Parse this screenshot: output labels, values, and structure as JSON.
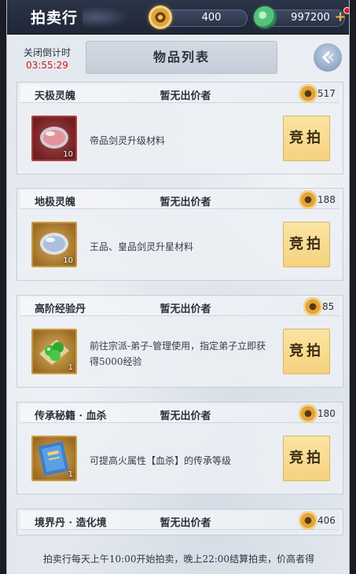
{
  "header": {
    "title": "拍卖行",
    "gold_amount": "400",
    "jade_amount": "997200",
    "plus_symbol": "+"
  },
  "subheader": {
    "countdown_label": "关闭倒计时",
    "countdown_time": "03:55:29",
    "list_title": "物品列表"
  },
  "items": [
    {
      "name": "天极灵魄",
      "bidder": "暂无出价者",
      "price": "517",
      "quantity": "10",
      "description": "帝品剑灵升级材料",
      "bid_label": "竞拍",
      "icon": "red-soul-stone-icon"
    },
    {
      "name": "地极灵魄",
      "bidder": "暂无出价者",
      "price": "188",
      "quantity": "10",
      "description": "王品、皇品剑灵升星材料",
      "bid_label": "竞拍",
      "icon": "gold-soul-stone-icon"
    },
    {
      "name": "高阶经验丹",
      "bidder": "暂无出价者",
      "price": "85",
      "quantity": "1",
      "description": "前往宗派-弟子-管理使用，指定弟子立即获得5000经验",
      "bid_label": "竞拍",
      "icon": "green-pill-icon"
    },
    {
      "name": "传承秘籍 · 血杀",
      "bidder": "暂无出价者",
      "price": "180",
      "quantity": "1",
      "description": "可提高火属性【血杀】的传承等级",
      "bid_label": "竞拍",
      "icon": "blue-book-icon"
    },
    {
      "name": "境界丹 · 造化境",
      "bidder": "暂无出价者",
      "price": "406"
    }
  ],
  "footer": {
    "note": "拍卖行每天上午10:00开始拍卖，晚上22:00结算拍卖，价高者得"
  }
}
